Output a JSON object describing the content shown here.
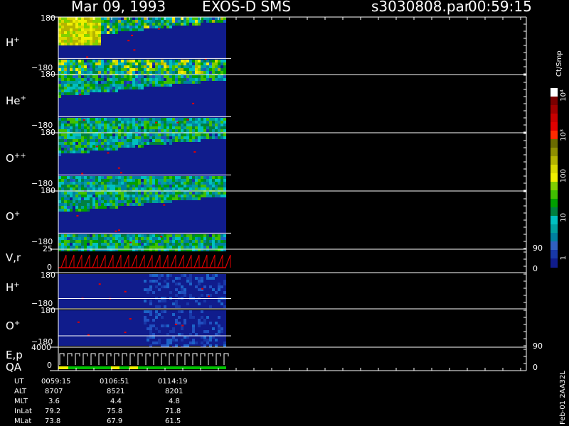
{
  "header": {
    "date": "Mar 09, 1993",
    "mission": "EXOS-D SMS",
    "filename": "s3030808.par",
    "time": "00:59:15"
  },
  "panels": [
    {
      "id": "h-plus-1",
      "label": "H",
      "charge": "+",
      "top_tick": "180",
      "bottom_tick": "−180"
    },
    {
      "id": "he-plus",
      "label": "He",
      "charge": "+",
      "top_tick": "180",
      "bottom_tick": "−180"
    },
    {
      "id": "o-plus-plus",
      "label": "O",
      "charge": "++",
      "top_tick": "180",
      "bottom_tick": "−180"
    },
    {
      "id": "o-plus-1",
      "label": "O",
      "charge": "+",
      "top_tick": "180",
      "bottom_tick": "−180"
    },
    {
      "id": "vr",
      "label": "V,r",
      "charge": "",
      "top_tick": "25",
      "bottom_tick": "0",
      "right_top": "90",
      "right_bottom": "0"
    },
    {
      "id": "h-plus-2",
      "label": "H",
      "charge": "+",
      "top_tick": "180",
      "bottom_tick": "−180"
    },
    {
      "id": "o-plus-2",
      "label": "O",
      "charge": "+",
      "top_tick": "180",
      "bottom_tick": "−180"
    },
    {
      "id": "ep",
      "label": "E,p",
      "label2": "QA",
      "charge": "",
      "top_tick": "4000",
      "bottom_tick": "0",
      "right_top": "90",
      "right_bottom": "0"
    }
  ],
  "colorbar": {
    "unit": "Ct/Smp",
    "labels": [
      "10⁴",
      "10³",
      "100",
      "10",
      "1"
    ],
    "colors": [
      "#ffffff",
      "#7a0000",
      "#a00000",
      "#c80000",
      "#e00000",
      "#ff2a00",
      "#6b6b00",
      "#8f8f00",
      "#b4b400",
      "#d9d900",
      "#f0f000",
      "#80d000",
      "#40c000",
      "#00a000",
      "#008040",
      "#00c0c0",
      "#00a0a0",
      "#0080a0",
      "#3060c0",
      "#1838a8",
      "#101c8c"
    ]
  },
  "ephemeris": {
    "labels": [
      "UT",
      "ALT",
      "MLT",
      "InLat",
      "MLat"
    ],
    "columns": [
      [
        "0059:15",
        "8707",
        "3.6",
        "79.2",
        "73.8"
      ],
      [
        "0106:51",
        "8521",
        "4.4",
        "75.8",
        "67.9"
      ],
      [
        "0114:19",
        "8201",
        "4.8",
        "71.8",
        "61.5"
      ]
    ]
  },
  "footer_code": "Feb-01 2AA32L"
}
